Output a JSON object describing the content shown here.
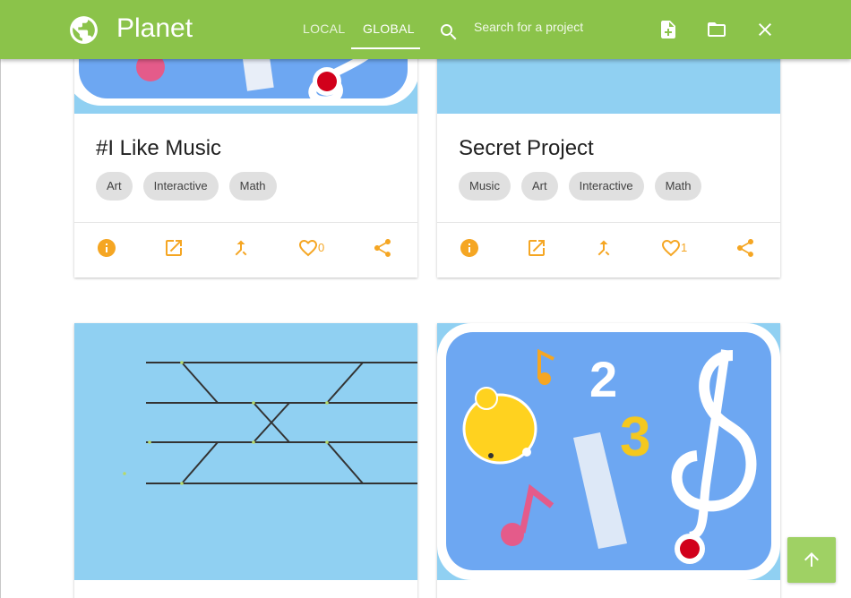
{
  "app": {
    "title": "Planet"
  },
  "tabs": [
    {
      "label": "LOCAL"
    },
    {
      "label": "GLOBAL",
      "active": true
    }
  ],
  "search": {
    "placeholder": "Search for a project",
    "value": ""
  },
  "toolbar": {
    "icons": [
      "new-project-icon",
      "open-folder-icon",
      "close-icon"
    ]
  },
  "colors": {
    "header": "#8bc34a",
    "accent": "#f5a623",
    "tag_bg": "#e0e0e0",
    "thumb_bg": "#90d0f2",
    "scroll_top_bg": "#9fd164"
  },
  "projects": [
    {
      "title": "#I Like Music",
      "tags": [
        "Art",
        "Interactive",
        "Math"
      ],
      "likes": "0"
    },
    {
      "title": "Secret Project",
      "tags": [
        "Music",
        "Art",
        "Interactive",
        "Math"
      ],
      "likes": "1"
    },
    {
      "title": "",
      "tags": [],
      "likes": ""
    },
    {
      "title": "",
      "tags": [],
      "likes": ""
    }
  ],
  "card_actions": [
    "info-icon",
    "open-in-new-icon",
    "merge-icon",
    "heart-icon",
    "share-icon"
  ],
  "scroll_top": {
    "icon": "arrow-up-icon"
  }
}
